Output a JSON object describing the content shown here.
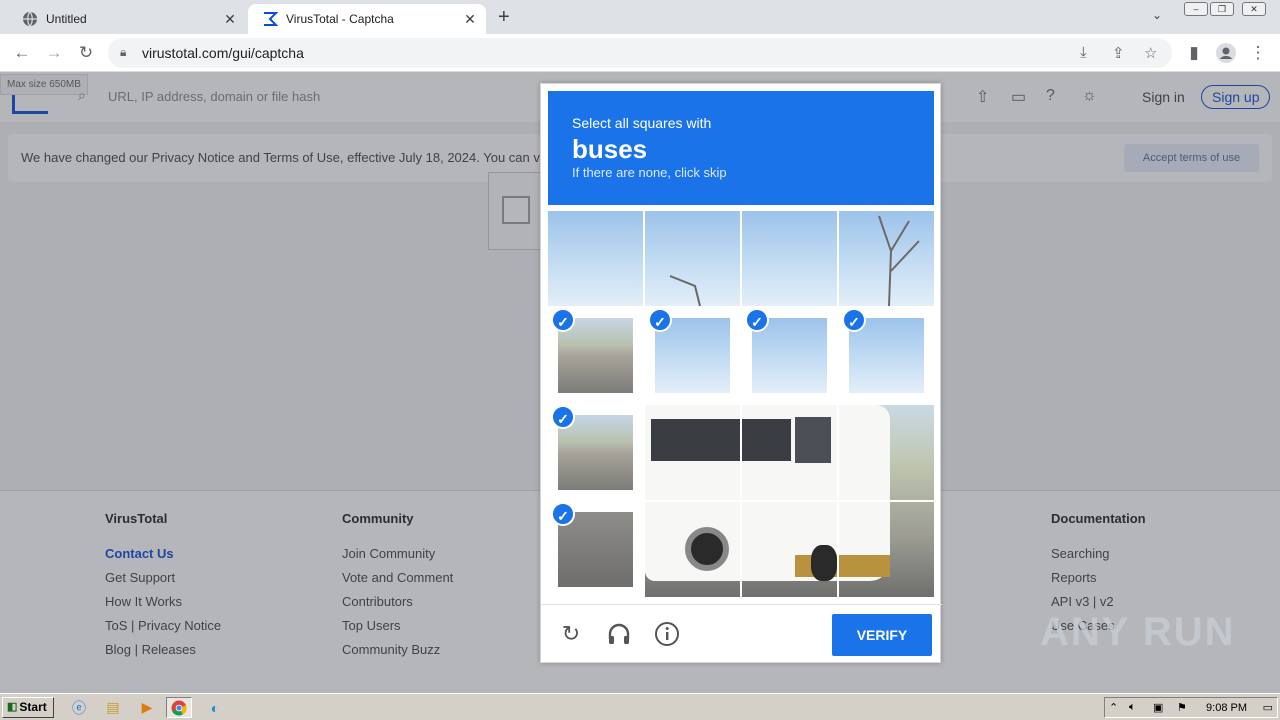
{
  "browser": {
    "tabs": [
      {
        "title": "Untitled",
        "active": false
      },
      {
        "title": "VirusTotal - Captcha",
        "active": true
      }
    ],
    "url": "virustotal.com/gui/captcha"
  },
  "page": {
    "max_size_label": "Max size 650MB",
    "search_placeholder": "URL, IP address, domain or file hash",
    "sign_in": "Sign in",
    "sign_up": "Sign up",
    "notice_text": "We have changed our Privacy Notice and Terms of Use, effective July 18, 2024. You can v",
    "accept_button": "Accept terms of use",
    "footer": {
      "col1": {
        "heading": "VirusTotal",
        "links": [
          "Contact Us",
          "Get Support",
          "How It Works",
          "ToS | Privacy Notice",
          "Blog | Releases"
        ]
      },
      "col2": {
        "heading": "Community",
        "links": [
          "Join Community",
          "Vote and Comment",
          "Contributors",
          "Top Users",
          "Community Buzz"
        ]
      },
      "col3": {
        "heading": "Documentation",
        "links": [
          "Searching",
          "Reports",
          "API v3 | v2",
          "Use Cases"
        ]
      }
    }
  },
  "captcha": {
    "line1": "Select all squares with",
    "target": "buses",
    "line3": "If there are none, click skip",
    "verify_label": "VERIFY",
    "selected_tiles": [
      4,
      5,
      6,
      7,
      8,
      12
    ]
  },
  "watermark": "ANY RUN",
  "taskbar": {
    "start": "Start",
    "clock": "9:08 PM"
  },
  "colors": {
    "captcha_blue": "#1a73e8",
    "vt_blue": "#0b4dda"
  }
}
